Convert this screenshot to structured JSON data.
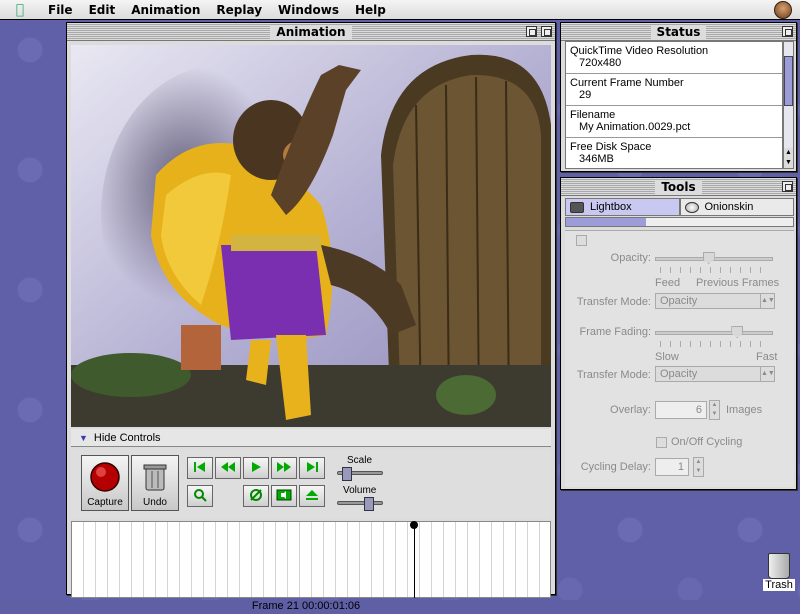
{
  "menubar": {
    "items": [
      "File",
      "Edit",
      "Animation",
      "Replay",
      "Windows",
      "Help"
    ]
  },
  "animation_window": {
    "title": "Animation",
    "hide_controls_label": "Hide Controls",
    "capture_label": "Capture",
    "undo_label": "Undo",
    "scale_label": "Scale",
    "volume_label": "Volume",
    "status_line": "Frame 21    00:00:01:06",
    "scale_value": 0.15,
    "volume_value": 0.75
  },
  "status_window": {
    "title": "Status",
    "items": [
      {
        "label": "QuickTime Video Resolution",
        "value": "720x480"
      },
      {
        "label": "Current Frame Number",
        "value": "29"
      },
      {
        "label": "Filename",
        "value": "My Animation.0029.pct"
      },
      {
        "label": "Free Disk Space",
        "value": "346MB"
      }
    ]
  },
  "tools_window": {
    "title": "Tools",
    "tabs": [
      "Lightbox",
      "Onionskin"
    ],
    "opacity_label": "Opacity:",
    "opacity_min": "Feed",
    "opacity_max": "Previous Frames",
    "opacity_value": 0.45,
    "transfer_mode_label": "Transfer Mode:",
    "transfer_mode_1": "Opacity",
    "frame_fading_label": "Frame Fading:",
    "fading_min": "Slow",
    "fading_max": "Fast",
    "fading_value": 0.72,
    "transfer_mode_2": "Opacity",
    "overlay_label": "Overlay:",
    "overlay_value": "6",
    "overlay_unit": "Images",
    "cycling_label": "On/Off Cycling",
    "cycling_delay_label": "Cycling Delay:",
    "cycling_delay_value": "1"
  },
  "desktop": {
    "trash_label": "Trash"
  }
}
